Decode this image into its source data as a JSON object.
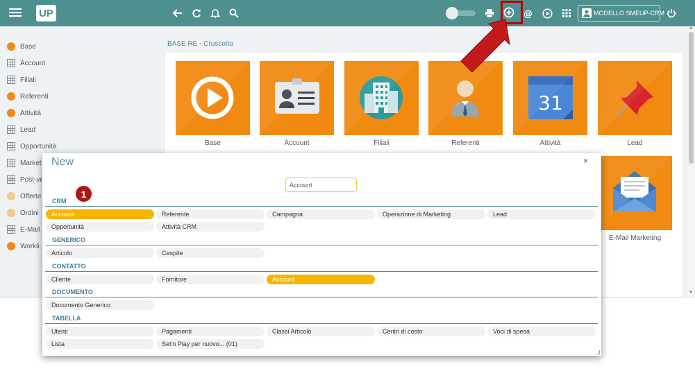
{
  "topbar": {
    "logo_text": "UP",
    "user_label": "MODELLO SMEUP-CRM",
    "icons": [
      "menu-icon",
      "back-icon",
      "refresh-icon",
      "bell-icon",
      "search-icon",
      "toggle-switch",
      "print-icon",
      "add-circle-icon",
      "at-icon",
      "play-circle-icon",
      "apps-grid-icon",
      "power-icon"
    ]
  },
  "sidebar": {
    "items": [
      {
        "label": "Base",
        "icon": "dot",
        "color": "#f18a10"
      },
      {
        "label": "Account",
        "icon": "grid"
      },
      {
        "label": "Filiali",
        "icon": "grid"
      },
      {
        "label": "Referenti",
        "icon": "dot",
        "color": "#f18a10"
      },
      {
        "label": "Attività",
        "icon": "dot",
        "color": "#f18a10"
      },
      {
        "label": "Lead",
        "icon": "grid"
      },
      {
        "label": "Opportunità",
        "icon": "grid"
      },
      {
        "label": "Market",
        "icon": "grid"
      },
      {
        "label": "Post-ve",
        "icon": "grid"
      },
      {
        "label": "Offerte",
        "icon": "dot",
        "color": "#f3c98c"
      },
      {
        "label": "Ordini",
        "icon": "dot",
        "color": "#f3c98c"
      },
      {
        "label": "E-Mail",
        "icon": "grid"
      },
      {
        "label": "Workli",
        "icon": "dot",
        "color": "#f18a10"
      }
    ]
  },
  "main": {
    "breadcrumb": "BASE RE - Cruscotto",
    "tiles": [
      {
        "label": "Base",
        "icon": "play-icon"
      },
      {
        "label": "Account",
        "icon": "id-card-icon"
      },
      {
        "label": "Filiali",
        "icon": "building-icon"
      },
      {
        "label": "Referenti",
        "icon": "person-icon"
      },
      {
        "label": "Attività",
        "icon": "calendar-icon",
        "calendar_day": "31"
      },
      {
        "label": "Lead",
        "icon": "pushpin-icon"
      }
    ],
    "extra_tile": {
      "label": "E-Mail Marketing",
      "icon": "envelope-icon"
    }
  },
  "modal": {
    "title": "New",
    "close": "×",
    "search_value": "Account",
    "badge": "1",
    "sections": [
      {
        "name": "CRM",
        "items": [
          "Account",
          "Referente",
          "Campagna",
          "Operazione di Marketing",
          "Lead",
          "Opportunità",
          "Attività CRM"
        ]
      },
      {
        "name": "GENERICO",
        "items": [
          "Articolo",
          "Cespite"
        ]
      },
      {
        "name": "CONTATTO",
        "items": [
          "Cliente",
          "Fornitore",
          "Account"
        ]
      },
      {
        "name": "DOCUMENTO",
        "items": [
          "Documento Generico"
        ]
      },
      {
        "name": "TABELLA",
        "items": [
          "Utenti",
          "Pagamenti",
          "Classi Articolo",
          "Centri di costo",
          "Voci di spesa",
          "Lista",
          "Set'n Play per nuovo... (01)"
        ]
      }
    ],
    "selected_color": "#f7b500"
  },
  "colors": {
    "topbar": "#4e8f8f",
    "tile": "#f18a10",
    "highlight": "#c00000",
    "arrow": "#c00000"
  }
}
